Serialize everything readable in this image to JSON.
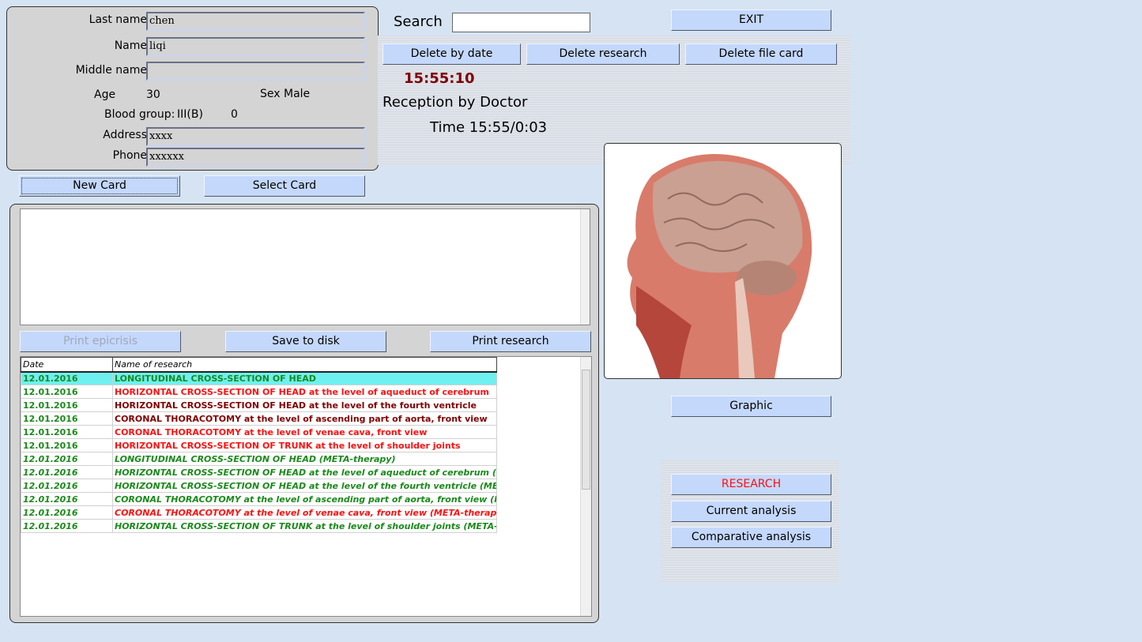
{
  "patient": {
    "last_name_label": "Last name",
    "last_name": "chen",
    "name_label": "Name",
    "name": "liqi",
    "middle_name_label": "Middle name",
    "middle_name": "",
    "age_label": "Age",
    "age": "30",
    "sex": "Sex Male",
    "blood_label": "Blood group:",
    "blood": "III(B)",
    "blood_rh": "0",
    "address_label": "Address",
    "address": "xxxx",
    "phone_label": "Phone",
    "phone": "xxxxxx"
  },
  "card_buttons": {
    "new": "New Card",
    "select": "Select Card"
  },
  "search": {
    "label": "Search",
    "value": ""
  },
  "exit": "EXIT",
  "delete": {
    "by_date": "Delete by date",
    "research": "Delete research",
    "file_card": "Delete file card"
  },
  "clock": "15:55:10",
  "reception": "Reception by Doctor",
  "time": "Time 15:55/0:03",
  "actions": {
    "print_epicrisis": "Print epicrisis",
    "save": "Save to disk",
    "print_research": "Print research"
  },
  "table": {
    "headers": [
      "Date",
      "Name of research"
    ],
    "rows": [
      {
        "date": "12.01.2016",
        "name": "LONGITUDINAL CROSS-SECTION OF HEAD",
        "color": "#1a8a1a",
        "italic": false,
        "selected": true
      },
      {
        "date": "12.01.2016",
        "name": "HORIZONTAL CROSS-SECTION OF HEAD at the level of aqueduct of cerebrum",
        "color": "#ff1010",
        "italic": false
      },
      {
        "date": "12.01.2016",
        "name": "HORIZONTAL CROSS-SECTION OF HEAD at the level of the fourth ventricle",
        "color": "#800000",
        "italic": false
      },
      {
        "date": "12.01.2016",
        "name": "CORONAL THORACOTOMY at the level of ascending part of aorta, front view",
        "color": "#800000",
        "italic": false
      },
      {
        "date": "12.01.2016",
        "name": "CORONAL THORACOTOMY at the level of venae cava, front view",
        "color": "#ff1010",
        "italic": false
      },
      {
        "date": "12.01.2016",
        "name": "HORIZONTAL CROSS-SECTION OF TRUNK at the level of shoulder joints",
        "color": "#ff1010",
        "italic": false
      },
      {
        "date": "12.01.2016",
        "name": "LONGITUDINAL CROSS-SECTION OF HEAD (META-therapy)",
        "color": "#1a8a1a",
        "italic": true
      },
      {
        "date": "12.01.2016",
        "name": "HORIZONTAL CROSS-SECTION OF HEAD at the level of aqueduct of cerebrum (META-the",
        "color": "#1a8a1a",
        "italic": true
      },
      {
        "date": "12.01.2016",
        "name": "HORIZONTAL CROSS-SECTION OF HEAD at the level of the fourth ventricle (META-thera",
        "color": "#1a8a1a",
        "italic": true
      },
      {
        "date": "12.01.2016",
        "name": "CORONAL THORACOTOMY at the level of ascending part of aorta, front view (META-the",
        "color": "#1a8a1a",
        "italic": true
      },
      {
        "date": "12.01.2016",
        "name": "CORONAL THORACOTOMY at the level of venae cava, front view (META-therapy)",
        "color": "#ff1010",
        "italic": true
      },
      {
        "date": "12.01.2016",
        "name": "HORIZONTAL CROSS-SECTION OF TRUNK at the level of shoulder joints (META-therapy)",
        "color": "#1a8a1a",
        "italic": true
      }
    ]
  },
  "date_color": "#1a8a1a",
  "graphic": "Graphic",
  "analysis": {
    "research": "RESEARCH",
    "current": "Current analysis",
    "comparative": "Comparative analysis"
  }
}
